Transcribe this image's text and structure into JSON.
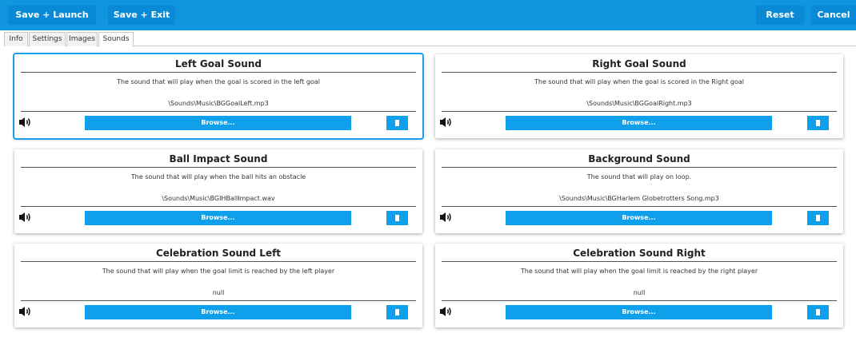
{
  "toolbar": {
    "save_launch_label": "Save + Launch",
    "save_exit_label": "Save + Exit",
    "reset_label": "Reset",
    "cancel_label": "Cancel"
  },
  "tabs": [
    "Info",
    "Settings",
    "Images",
    "Sounds"
  ],
  "active_tab": "Sounds",
  "cards": [
    {
      "title": "Left Goal Sound",
      "description": "The sound that will play when the goal is scored in the left goal",
      "path": "\\Sounds\\Music\\BGGoalLeft.mp3",
      "browse_label": "Browse..."
    },
    {
      "title": "Right Goal Sound",
      "description": "The sound that will play when the goal is scored in the Right goal",
      "path": "\\Sounds\\Music\\BGGoalRight.mp3",
      "browse_label": "Browse..."
    },
    {
      "title": "Ball Impact Sound",
      "description": "The sound that will play  when the ball hits an obstacle",
      "path": "\\Sounds\\Music\\BGIHBallImpact.wav",
      "browse_label": "Browse..."
    },
    {
      "title": "Background Sound",
      "description": "The sound that will play on loop.",
      "path": "\\Sounds\\Music\\BGHarlem Globetrotters Song.mp3",
      "browse_label": "Browse..."
    },
    {
      "title": "Celebration Sound Left",
      "description": "The sound that will play when the goal limit is reached by the left player",
      "path": "null",
      "browse_label": "Browse..."
    },
    {
      "title": "Celebration Sound Right",
      "description": "The sound that will play when the goal limit is reached by the right player",
      "path": "null",
      "browse_label": "Browse..."
    }
  ],
  "icons": {
    "play": "speaker-icon",
    "delete": "trash-icon"
  },
  "colors": {
    "toolbar": "#1096df",
    "accent": "#0ea0ea",
    "selection": "#1aa0e6"
  }
}
